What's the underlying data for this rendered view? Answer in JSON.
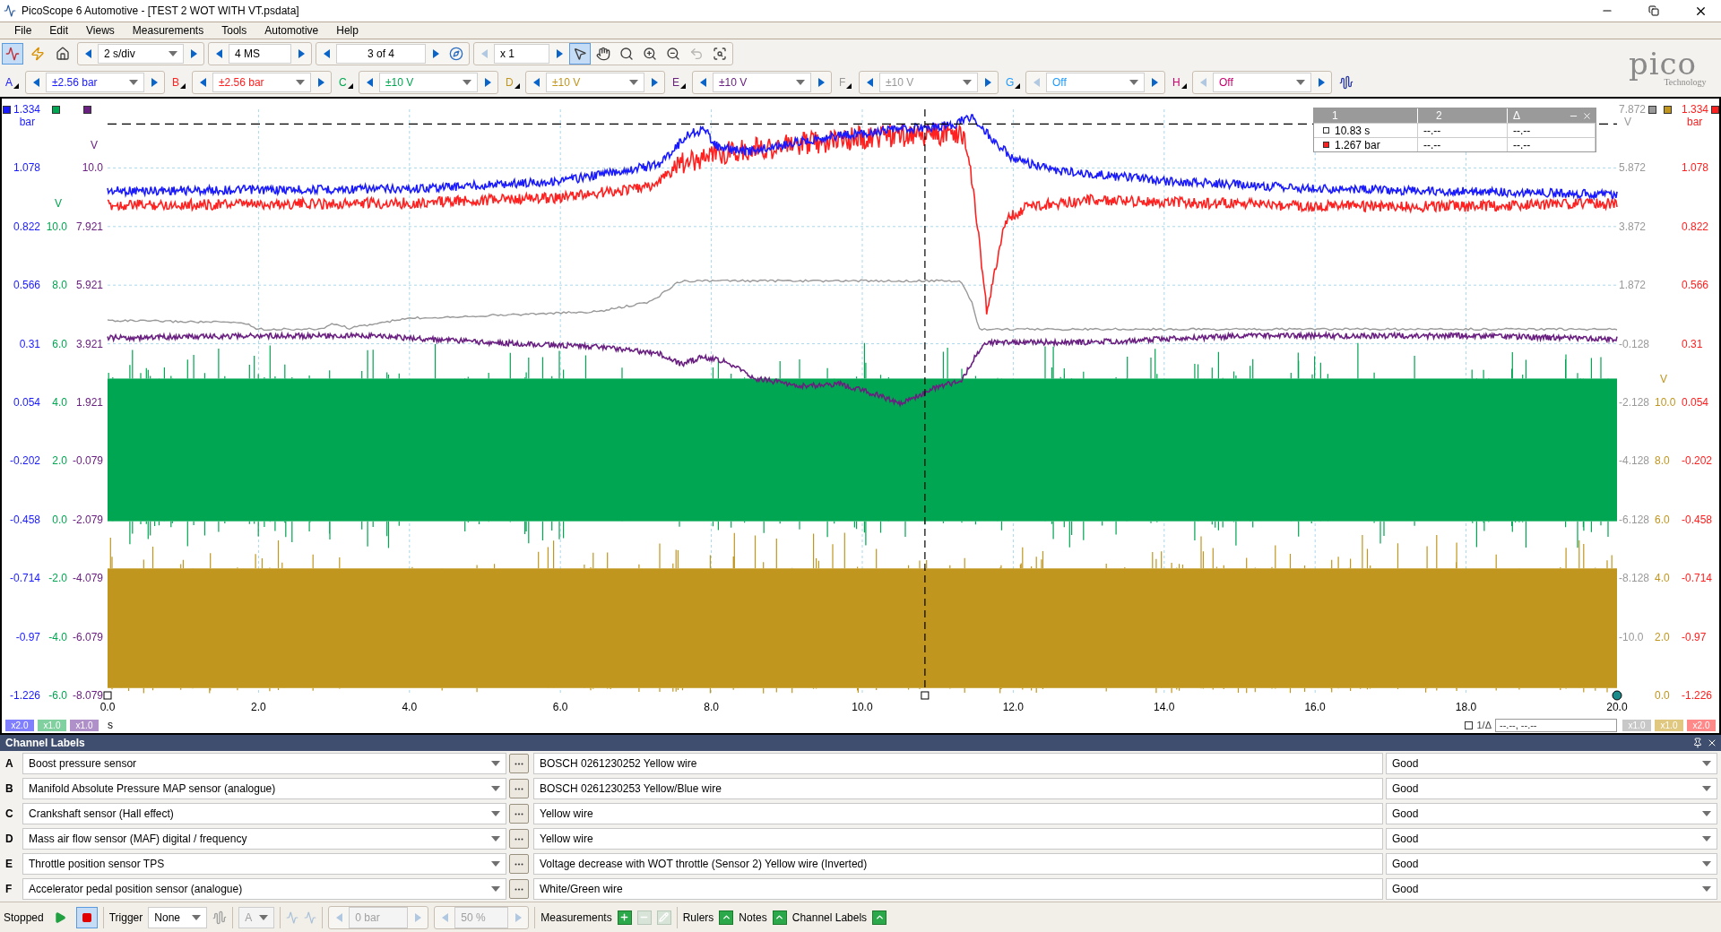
{
  "window": {
    "title": "PicoScope 6 Automotive - [TEST 2 WOT WITH VT.psdata]"
  },
  "menu": [
    "File",
    "Edit",
    "Views",
    "Measurements",
    "Tools",
    "Automotive",
    "Help"
  ],
  "toolbar": {
    "mode_buttons": [
      {
        "kind": "scope",
        "selected": true
      },
      {
        "kind": "auto-setup",
        "selected": false
      },
      {
        "kind": "home",
        "selected": false
      }
    ],
    "timebase": "2 s/div",
    "samples": "4 MS",
    "buffer": "3 of 4",
    "zoom_factor": "x 1",
    "zoom_previous_disabled": true,
    "tools": [
      {
        "kind": "pointer",
        "selected": true,
        "disabled": false
      },
      {
        "kind": "hand",
        "selected": false,
        "disabled": false
      },
      {
        "kind": "zoom",
        "selected": false,
        "disabled": false
      },
      {
        "kind": "zoom-in",
        "selected": false,
        "disabled": false
      },
      {
        "kind": "zoom-out",
        "selected": false,
        "disabled": false
      },
      {
        "kind": "undo",
        "selected": false,
        "disabled": true
      },
      {
        "kind": "zoom-fit",
        "selected": false,
        "disabled": false
      }
    ]
  },
  "logo": {
    "name": "pico",
    "tagline": "Technology"
  },
  "channels": [
    {
      "letter": "A",
      "range": "±2.56 bar",
      "color": "#1a1aff",
      "previous_disabled": false
    },
    {
      "letter": "B",
      "range": "±2.56 bar",
      "color": "#ff2020",
      "previous_disabled": false
    },
    {
      "letter": "C",
      "range": "±10 V",
      "color": "#00a651",
      "previous_disabled": false
    },
    {
      "letter": "D",
      "range": "±10 V",
      "color": "#c0961e",
      "previous_disabled": false
    },
    {
      "letter": "E",
      "range": "±10 V",
      "color": "#6a2080",
      "previous_disabled": false
    },
    {
      "letter": "F",
      "range": "±10 V",
      "color": "#999999",
      "previous_disabled": false
    },
    {
      "letter": "G",
      "range": "Off",
      "color": "#1e9bff",
      "previous_disabled": true
    },
    {
      "letter": "H",
      "range": "Off",
      "color": "#c8006e",
      "previous_disabled": true
    }
  ],
  "plot": {
    "left_axes": [
      {
        "color": "#1a1aff",
        "unit": "bar",
        "kind": "top",
        "ticks": [
          "1.334",
          "1.078",
          "0.822",
          "0.566",
          "0.31",
          "0.054",
          "-0.202",
          "-0.458",
          "-0.714",
          "-0.97",
          "-1.226"
        ]
      },
      {
        "color": "#00a651",
        "unit": "V",
        "kind": "bottom",
        "ticks": [
          "10.0",
          "8.0",
          "6.0",
          "4.0",
          "2.0",
          "0.0",
          "-2.0",
          "-4.0",
          "-6.0"
        ]
      },
      {
        "color": "#6a2080",
        "unit": "V",
        "kind": "bottom",
        "ticks": [
          "10.0",
          "7.921",
          "5.921",
          "3.921",
          "1.921",
          "-0.079",
          "-2.079",
          "-4.079",
          "-6.079",
          "-8.079"
        ]
      }
    ],
    "right_axes": [
      {
        "color": "#999999",
        "unit": "V",
        "kind": "top",
        "ticks": [
          "7.872",
          "5.872",
          "3.872",
          "1.872",
          "-0.128",
          "-2.128",
          "-4.128",
          "-6.128",
          "-8.128",
          "-10.0"
        ]
      },
      {
        "color": "#c0961e",
        "unit": "V",
        "kind": "bottom",
        "ticks": [
          "10.0",
          "8.0",
          "6.0",
          "4.0",
          "2.0",
          "0.0"
        ]
      },
      {
        "color": "#ff2020",
        "unit": "bar",
        "kind": "top",
        "ticks": [
          "1.334",
          "1.078",
          "0.822",
          "0.566",
          "0.31",
          "0.054",
          "-0.202",
          "-0.458",
          "-0.714",
          "-0.97",
          "-1.226"
        ]
      }
    ],
    "x_ticks": [
      "0.0",
      "2.0",
      "4.0",
      "6.0",
      "8.0",
      "10.0",
      "12.0",
      "14.0",
      "16.0",
      "18.0",
      "20.0"
    ],
    "x_unit": "s",
    "scale_tags_left": [
      {
        "text": "x2.0",
        "color": "#8080ff"
      },
      {
        "text": "x1.0",
        "color": "#80d0a0"
      },
      {
        "text": "x1.0",
        "color": "#b090c8"
      }
    ],
    "scale_tags_right": [
      {
        "text": "x1.0",
        "color": "#c8c8c8"
      },
      {
        "text": "x1.0",
        "color": "#e0c880"
      },
      {
        "text": "x2.0",
        "color": "#ff8888"
      }
    ],
    "ruler_table": {
      "headers": [
        "1",
        "2",
        "Δ"
      ],
      "rows": [
        {
          "color": "#ffffff",
          "cells": [
            "10.83 s",
            "--.--",
            "--.--"
          ]
        },
        {
          "color": "#ff2020",
          "cells": [
            "1.267 bar",
            "--.--",
            "--.--"
          ]
        }
      ]
    },
    "ruler_readout": {
      "label": "1/Δ",
      "value": "--.--, --.--"
    }
  },
  "channel_labels": {
    "title": "Channel Labels",
    "rows": [
      {
        "letter": "A",
        "sensor": "Boost pressure sensor",
        "notes": "BOSCH 0261230252 Yellow wire",
        "status": "Good"
      },
      {
        "letter": "B",
        "sensor": "Manifold Absolute Pressure MAP sensor (analogue)",
        "notes": "BOSCH 0261230253 Yellow/Blue wire",
        "status": "Good"
      },
      {
        "letter": "C",
        "sensor": "Crankshaft sensor (Hall effect)",
        "notes": "Yellow wire",
        "status": "Good"
      },
      {
        "letter": "D",
        "sensor": "Mass air flow sensor (MAF) digital / frequency",
        "notes": "Yellow wire",
        "status": "Good"
      },
      {
        "letter": "E",
        "sensor": "Throttle position sensor TPS",
        "notes": "Voltage decrease with WOT throttle (Sensor 2) Yellow wire (Inverted)",
        "status": "Good"
      },
      {
        "letter": "F",
        "sensor": "Accelerator pedal position sensor (analogue)",
        "notes": "White/Green wire",
        "status": "Good"
      }
    ]
  },
  "status_bar": {
    "state": "Stopped",
    "run_buttons": [
      {
        "kind": "play",
        "selected": false
      },
      {
        "kind": "stop",
        "selected": true
      }
    ],
    "trigger_label": "Trigger",
    "trigger_mode": "None",
    "trigger_channel": {
      "value": "A",
      "disabled": true
    },
    "threshold": {
      "value": "0 bar",
      "disabled": true
    },
    "pretrigger": {
      "value": "50 %",
      "disabled": true
    },
    "panels": [
      {
        "label": "Measurements",
        "buttons": [
          {
            "kind": "add",
            "disabled": false
          },
          {
            "kind": "remove",
            "disabled": true
          },
          {
            "kind": "edit",
            "disabled": true
          }
        ]
      },
      {
        "label": "Rulers",
        "buttons": [
          {
            "kind": "toggle",
            "disabled": false
          }
        ]
      },
      {
        "label": "Notes",
        "buttons": [
          {
            "kind": "toggle",
            "disabled": false
          }
        ]
      },
      {
        "label": "Channel Labels",
        "buttons": [
          {
            "kind": "toggle",
            "disabled": false
          }
        ]
      }
    ]
  }
}
